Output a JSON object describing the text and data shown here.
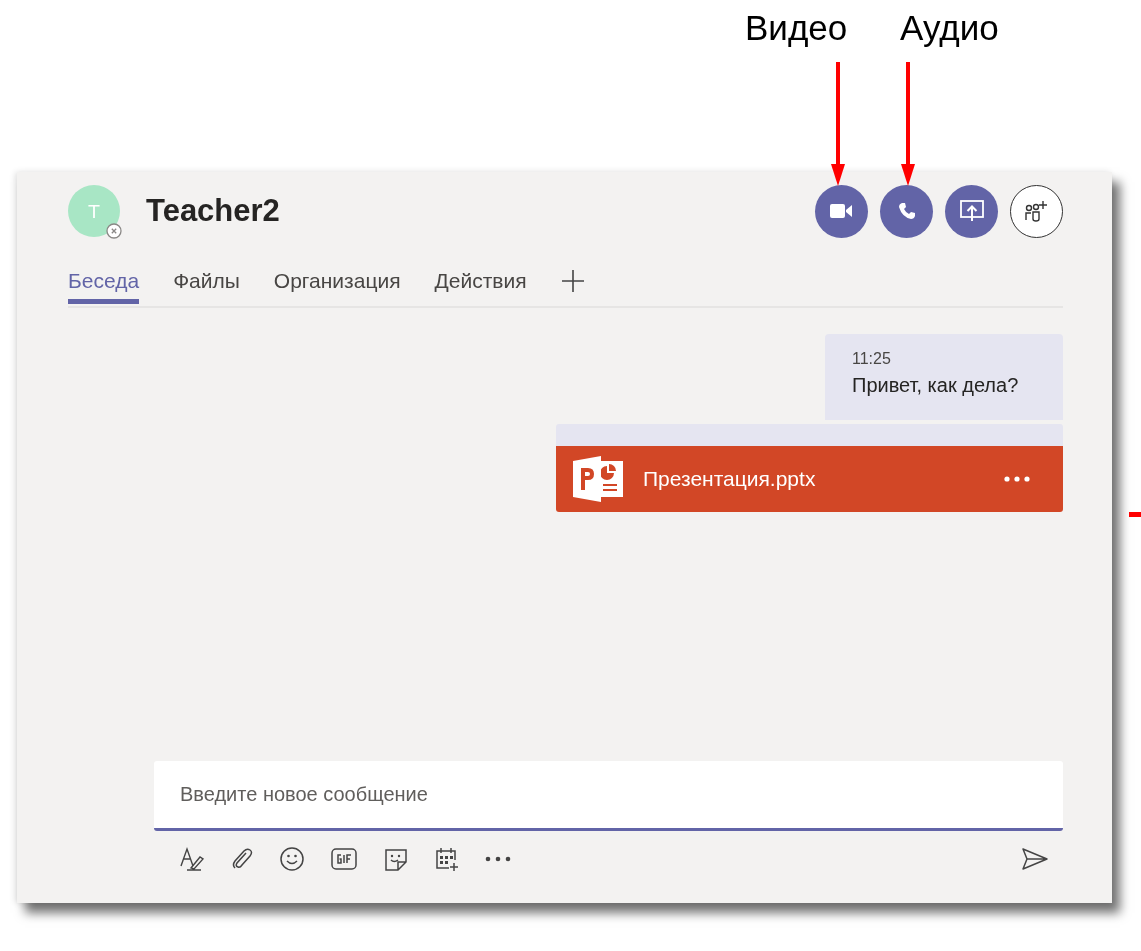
{
  "annotations": [
    {
      "label": "Видео"
    },
    {
      "label": "Аудио"
    }
  ],
  "header": {
    "avatar_initial": "T",
    "title": "Teacher2"
  },
  "tabs": [
    {
      "label": "Беседа",
      "selected": true
    },
    {
      "label": "Файлы",
      "selected": false
    },
    {
      "label": "Организация",
      "selected": false
    },
    {
      "label": "Действия",
      "selected": false
    }
  ],
  "message": {
    "time": "11:25",
    "text": "Привет, как дела?"
  },
  "attachment": {
    "file_name": "Презентация.pptx"
  },
  "compose": {
    "placeholder": "Введите новое сообщение"
  }
}
